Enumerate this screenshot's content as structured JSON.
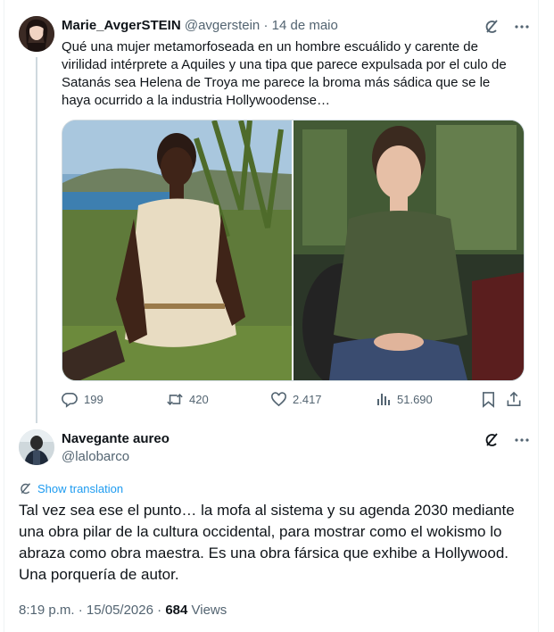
{
  "original_tweet": {
    "display_name": "Marie_AvgerSTEIN",
    "handle": "@avgerstein",
    "separator": "·",
    "date": "14 de maio",
    "text": "Qué una mujer metamorfoseada en un hombre escuálido y carente de virilidad intérprete a Aquiles y una tipa que parece expulsada por el culo de Satanás sea Helena de Troya me parece la broma más sádica que se le haya ocurrido a la industria Hollywoodense…",
    "actions": {
      "replies": "199",
      "retweets": "420",
      "likes": "2.417",
      "views": "51.690"
    }
  },
  "reply_tweet": {
    "display_name": "Navegante aureo",
    "handle": "@lalobarco",
    "translate_label": "Show translation",
    "text": "Tal vez sea ese el punto… la mofa al sistema y su agenda 2030 mediante una obra pilar de la cultura occidental, para mostrar como el wokismo lo abraza como obra maestra. Es una obra fársica que exhibe a Hollywood. Una porquería de autor.",
    "time": "8:19 p.m.",
    "date": "15/05/2026",
    "views_count": "684",
    "views_label": "Views"
  },
  "icons": [
    "grok-icon",
    "more-icon",
    "reply-icon",
    "retweet-icon",
    "like-icon",
    "views-icon",
    "bookmark-icon",
    "share-icon",
    "translate-icon"
  ],
  "colors": {
    "text": "#0f1419",
    "muted": "#536471",
    "link": "#1d9bf0",
    "border": "#cfd9de"
  }
}
